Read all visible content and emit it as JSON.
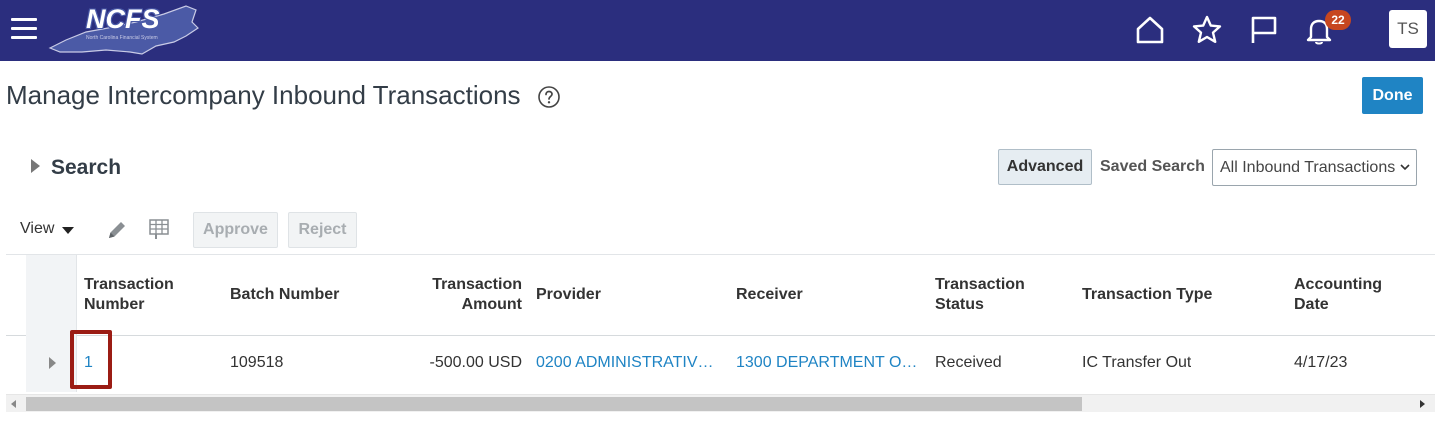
{
  "header": {
    "logo_text": "NCFS",
    "logo_subtext": "North Carolina Financial System",
    "notification_count": "22",
    "avatar_initials": "TS",
    "icons": [
      "menu-icon",
      "home-icon",
      "star-icon",
      "flag-icon",
      "bell-icon"
    ]
  },
  "page": {
    "title": "Manage Intercompany Inbound Transactions",
    "done_label": "Done"
  },
  "search": {
    "label": "Search",
    "advanced_label": "Advanced",
    "saved_search_label": "Saved Search",
    "saved_search_value": "All Inbound Transactions"
  },
  "toolbar": {
    "view_label": "View",
    "approve_label": "Approve",
    "reject_label": "Reject"
  },
  "table": {
    "headers": {
      "transaction_number": [
        "Transaction",
        "Number"
      ],
      "batch_number": "Batch Number",
      "transaction_amount": [
        "Transaction",
        "Amount"
      ],
      "provider": "Provider",
      "receiver": "Receiver",
      "transaction_status": [
        "Transaction",
        "Status"
      ],
      "transaction_type": "Transaction Type",
      "accounting_date": [
        "Accounting",
        "Date"
      ]
    },
    "rows": [
      {
        "transaction_number": "1",
        "batch_number": "109518",
        "transaction_amount": "-500.00 USD",
        "provider": "0200 ADMINISTRATIV…",
        "receiver": "1300 DEPARTMENT O…",
        "transaction_status": "Received",
        "transaction_type": "IC Transfer Out",
        "accounting_date": "4/17/23"
      }
    ]
  },
  "colors": {
    "header_bg": "#2b2e7e",
    "primary_button": "#1f84c4",
    "link": "#1f84c4",
    "badge": "#c7461f",
    "highlight_box": "#9b1c14"
  }
}
